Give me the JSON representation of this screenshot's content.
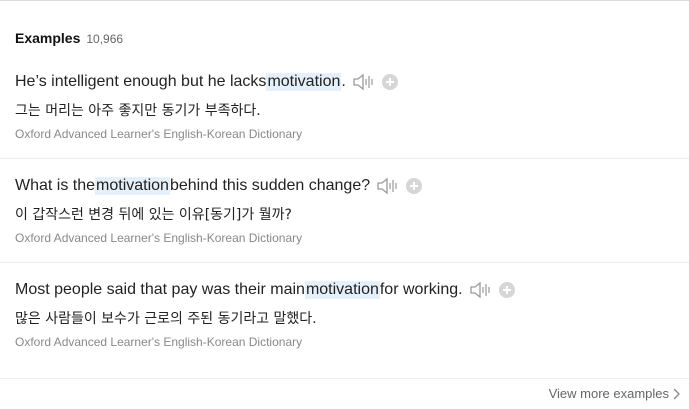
{
  "header": {
    "title": "Examples",
    "count": "10,966"
  },
  "examples": [
    {
      "en_before": "He’s intelligent enough but he lacks ",
      "en_highlight": "motivation",
      "en_after": ".",
      "ko": "그는 머리는 아주 좋지만 동기가 부족하다.",
      "source": "Oxford Advanced Learner's English-Korean Dictionary"
    },
    {
      "en_before": "What is the ",
      "en_highlight": "motivation",
      "en_after": " behind this sudden change?",
      "ko": "이 갑작스런 변경 뒤에 있는 이유[동기]가 뭘까?",
      "source": "Oxford Advanced Learner's English-Korean Dictionary"
    },
    {
      "en_before": "Most people said that pay was their main ",
      "en_highlight": "motivation",
      "en_after": " for working.",
      "ko": "많은 사람들이 보수가 근로의 주된 동기라고 말했다.",
      "source": "Oxford Advanced Learner's English-Korean Dictionary"
    }
  ],
  "footer": {
    "view_more_label": "View more examples"
  },
  "colors": {
    "highlight_bg": "#e5f0fb",
    "source_text": "#888888",
    "icon_gray": "#9a9a9a"
  },
  "icons": {
    "speaker": "speaker-icon",
    "add": "plus-circle-icon",
    "chevron": "chevron-right-icon"
  }
}
